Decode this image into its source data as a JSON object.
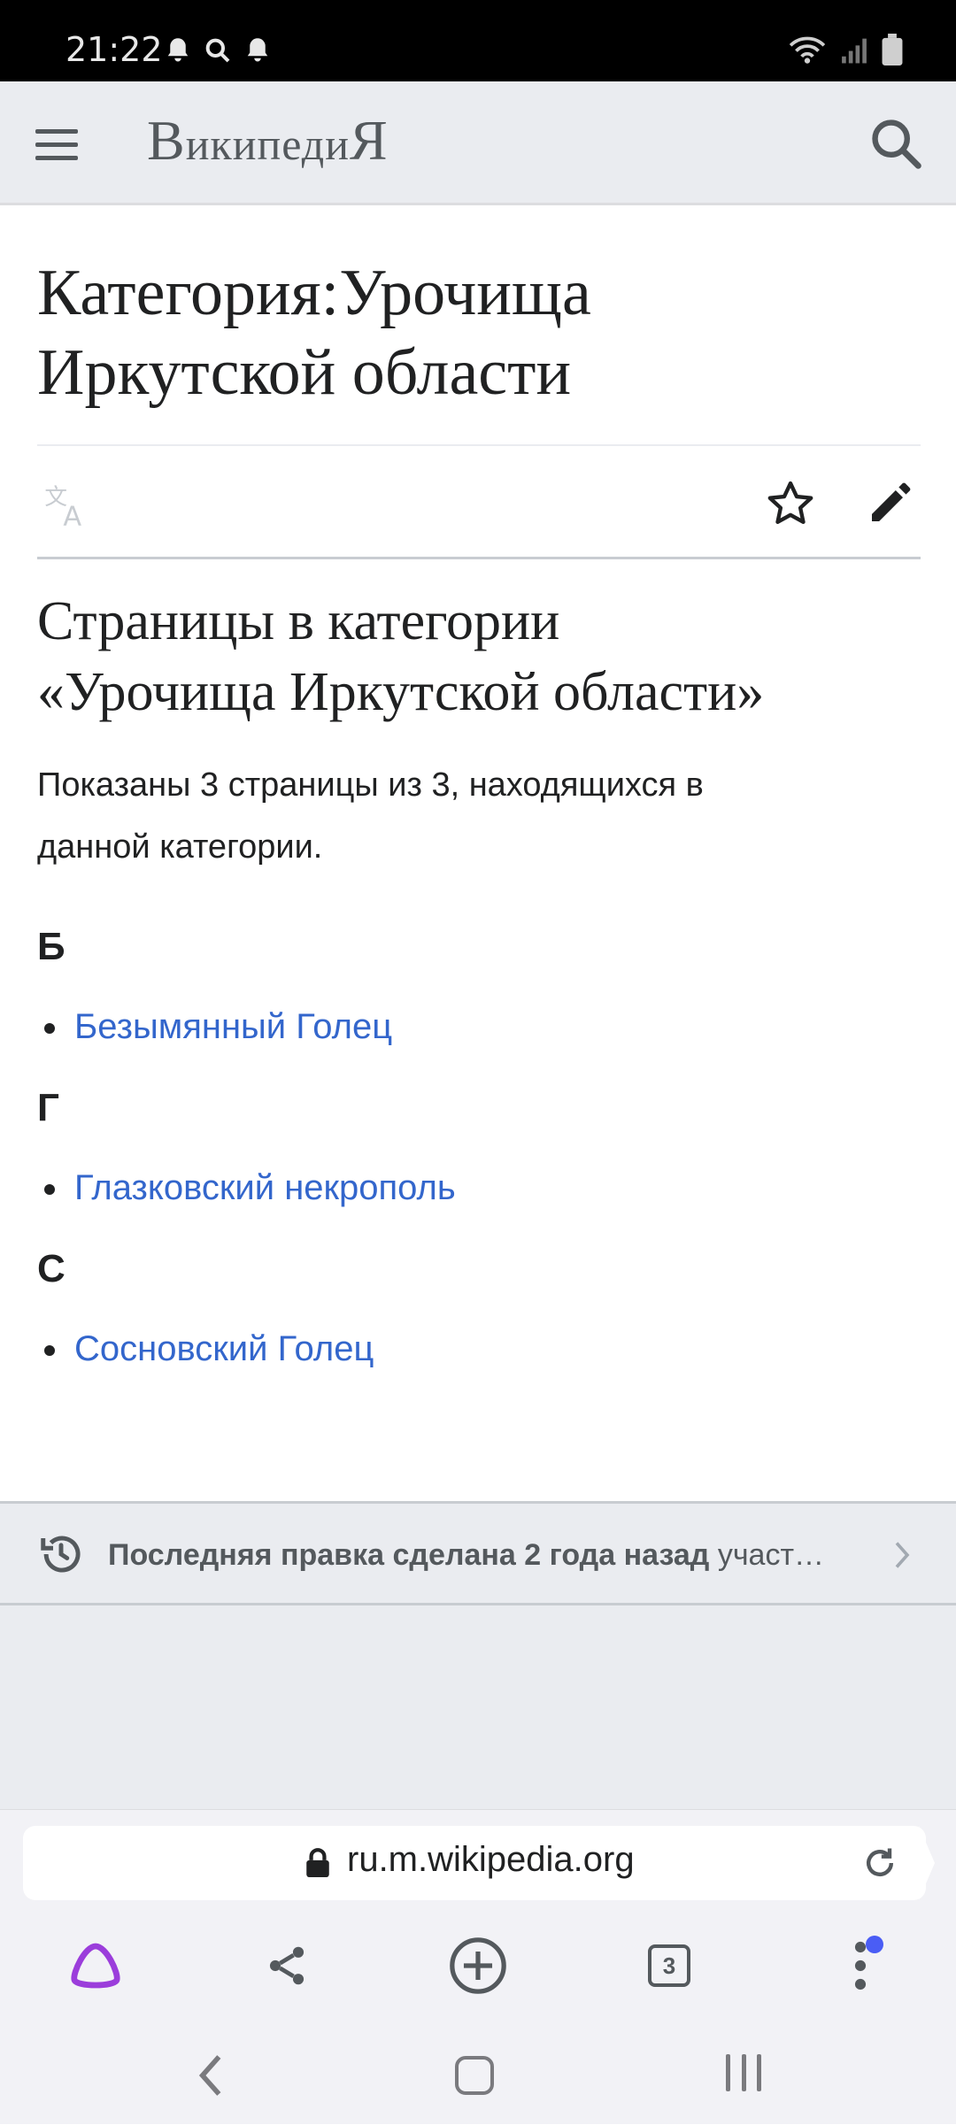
{
  "status": {
    "time": "21:22"
  },
  "header": {
    "wordmark_main": "Википеди",
    "wordmark_end": "Я",
    "wordmark_first": "В",
    "wordmark_rest": "икипеди"
  },
  "page": {
    "title_line1": "Категория:Урочища",
    "title_line2": "Иркутской области",
    "section_heading_line1": "Страницы в категории",
    "section_heading_line2": "«Урочища Иркутской области»",
    "count_text_line1": "Показаны 3 страницы из 3, находящихся в",
    "count_text_line2": "данной категории."
  },
  "groups": [
    {
      "letter": "Б",
      "items": [
        "Безымянный Голец"
      ]
    },
    {
      "letter": "Г",
      "items": [
        "Глазковский некрополь"
      ]
    },
    {
      "letter": "С",
      "items": [
        "Сосновский Голец"
      ]
    }
  ],
  "last_modified": {
    "bold": "Последняя правка сделана 2 года назад",
    "rest": " участ…"
  },
  "browser": {
    "url": "ru.m.wikipedia.org",
    "tab_count": "3"
  },
  "colors": {
    "link": "#3366cc",
    "header_bg": "#eaecf0",
    "alice_purple": "#9b3ddb",
    "badge_blue": "#4a5df5"
  }
}
